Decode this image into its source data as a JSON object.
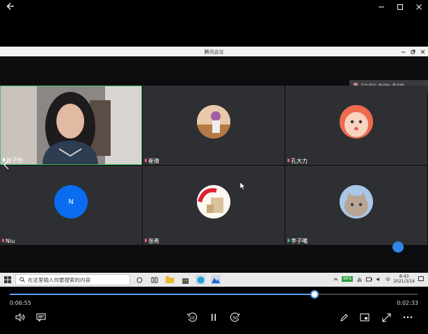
{
  "meeting": {
    "title": "腾讯会议"
  },
  "speaking": {
    "text": "正在讲话: 张子怡; 李子曦;"
  },
  "participants": [
    {
      "name": "张子怡",
      "type": "video"
    },
    {
      "name": "崔倩",
      "type": "photo"
    },
    {
      "name": "孔大力",
      "type": "photo"
    },
    {
      "name": "Niu",
      "type": "initial",
      "initial": "N",
      "color": "#0a6cf0"
    },
    {
      "name": "张希",
      "type": "photo"
    },
    {
      "name": "李子曦",
      "type": "photo"
    }
  ],
  "taskbar": {
    "search_placeholder": "在这里输入你要搜索的内容",
    "battery": "96%",
    "input_method": "中",
    "time": "8:43",
    "date": "2021/3/14"
  },
  "player": {
    "elapsed": "0:06:55",
    "remaining": "0:02:33",
    "progress_fraction": 0.7474,
    "skip_back_label": "10",
    "skip_forward_label": "30"
  },
  "colors": {
    "accent": "#5aa3f0",
    "tile": "#2e2f33"
  }
}
